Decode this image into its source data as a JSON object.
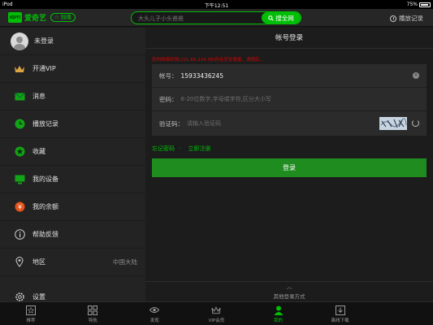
{
  "status_bar": {
    "carrier": "iPod",
    "time": "下午12:51",
    "battery": "75%"
  },
  "top_bar": {
    "logo_mark": "iQIYI",
    "logo_text": "爱奇艺",
    "follow_tag": "☆ 独播",
    "search_placeholder": "大头儿子小头爸爸",
    "search_button": "搜全网",
    "history_label": "播放记录"
  },
  "sidebar": {
    "user_label": "未登录",
    "items": [
      {
        "label": "开通VIP",
        "icon": "crown-icon"
      },
      {
        "label": "消息",
        "icon": "mail-icon"
      },
      {
        "label": "播放记录",
        "icon": "clock-icon"
      },
      {
        "label": "收藏",
        "icon": "star-icon"
      },
      {
        "label": "我的设备",
        "icon": "monitor-icon"
      },
      {
        "label": "我的余额",
        "icon": "coin-icon"
      },
      {
        "label": "帮助反馈",
        "icon": "info-icon"
      },
      {
        "label": "地区",
        "value": "中国大陆",
        "icon": "location-icon"
      },
      {
        "label": "设置",
        "icon": "gear-icon"
      }
    ]
  },
  "main": {
    "title": "帐号登录",
    "error_text": "您的网络环境(101.69.224.38)存在安全隐患，请稍后...",
    "account_label": "帐号：",
    "account_value": "15933436245",
    "password_label": "密码：",
    "password_placeholder": "6-20位数字,字母或字符,区分大小写",
    "captcha_label": "验证码：",
    "captcha_placeholder": "请输入验证码",
    "forgot_password": "忘记密码",
    "separator": "·",
    "register": "立即注册",
    "login_button": "登录",
    "other_login": "其他登录方式"
  },
  "bottom_nav": [
    {
      "label": "推荐",
      "icon": "star-box-icon"
    },
    {
      "label": "导航",
      "icon": "grid-icon"
    },
    {
      "label": "发现",
      "icon": "eye-icon"
    },
    {
      "label": "VIP会员",
      "icon": "crown-icon"
    },
    {
      "label": "我的",
      "icon": "person-icon",
      "active": true
    },
    {
      "label": "离线下载",
      "icon": "download-icon"
    }
  ],
  "colors": {
    "accent": "#00be06",
    "login_button": "#1e8c1e",
    "error": "#dd0000"
  }
}
